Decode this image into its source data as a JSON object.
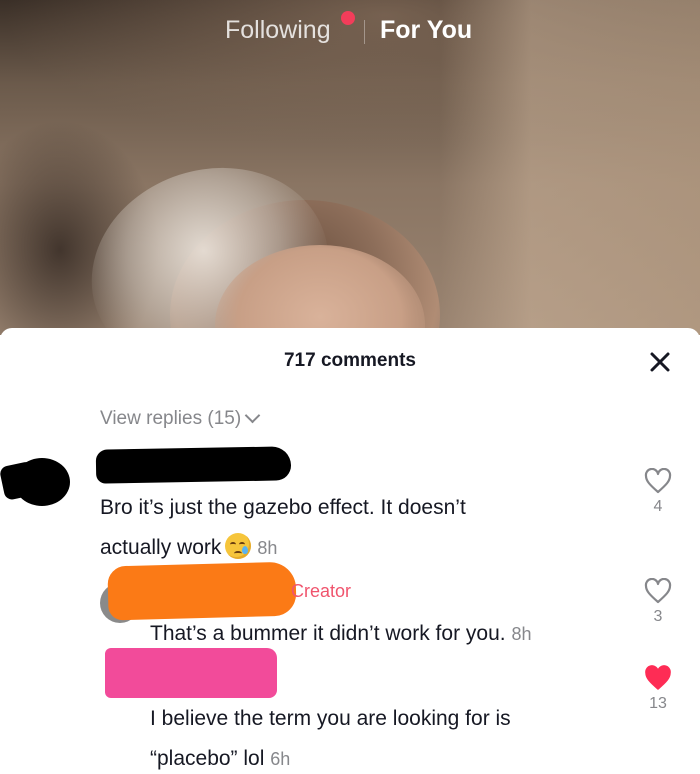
{
  "nav": {
    "following": "Following",
    "for_you": "For You"
  },
  "sheet": {
    "title": "717 comments",
    "close_icon": "close-icon"
  },
  "view_replies": "View replies (15)",
  "comments": [
    {
      "text_line1": "Bro it’s just the gazebo effect. It doesn’t",
      "text_line2": "actually work",
      "emoji": "crying-face-emoji",
      "time": "8h",
      "likes": "4",
      "liked": false
    },
    {
      "badge": "Creator",
      "text": "That’s a bummer it didn’t work for you.",
      "time": "8h",
      "likes": "3",
      "liked": false
    },
    {
      "text_line1": "I believe the term you are looking for is",
      "text_line2": "“placebo” lol",
      "time": "6h",
      "likes": "13",
      "liked": true
    }
  ],
  "colors": {
    "live_dot": "#f23d5a",
    "creator_label": "#f0546d",
    "liked_heart": "#fe2c55",
    "redact_orange": "#fb7a16",
    "redact_pink": "#f24b9a"
  }
}
